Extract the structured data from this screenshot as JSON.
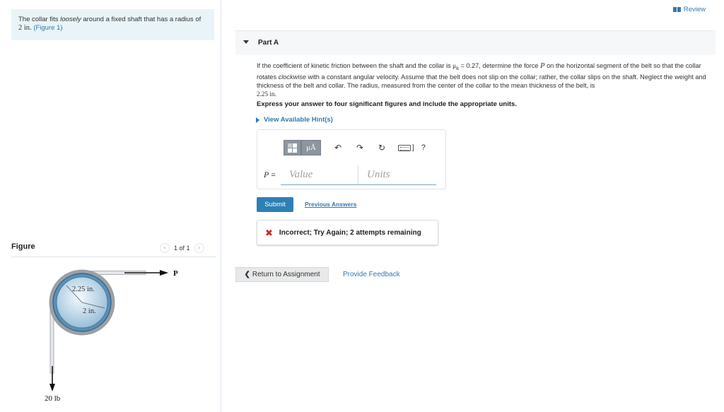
{
  "intro": {
    "text_1": "The collar fits ",
    "text_italic": "loosely",
    "text_2": " around a fixed shaft that has a radius of",
    "radius_value": "2 in.",
    "figure_link": "(Figure 1)"
  },
  "review": {
    "label": "Review"
  },
  "part": {
    "title": "Part A"
  },
  "problem": {
    "s1": "If the coefficient of kinetic friction between the shaft and the collar is ",
    "mu_symbol": "μ",
    "mu_sub": "k",
    "s2": " = 0.27, determine the force ",
    "P": "P",
    "s3": " on the horizontal segment of the belt so that the collar rotates ",
    "clockwise": "clockwise",
    "s4": " with a constant angular velocity. Assume that the belt does not slip on the collar; rather, the collar slips on the shaft. Neglect the weight and thickness of the belt and collar. The radius, measured from the center of the collar to the mean thickness of the belt, is ",
    "radius": "2.25 in."
  },
  "instruction": "Express your answer to four significant figures and include the appropriate units.",
  "hints": {
    "label": "View Available Hint(s)"
  },
  "answer": {
    "variable": "P",
    "equals": "=",
    "value_placeholder": "Value",
    "units_placeholder": "Units",
    "toolbar": {
      "mu_label": "μÅ",
      "undo_glyph": "↶",
      "redo_glyph": "↷",
      "reset_glyph": "↻",
      "bracket": "]",
      "help": "?"
    }
  },
  "actions": {
    "submit": "Submit",
    "previous_answers": "Previous Answers"
  },
  "feedback": {
    "icon": "✖",
    "text": "Incorrect; Try Again; 2 attempts remaining"
  },
  "footer": {
    "return_chevron": "❮",
    "return_label": "Return to Assignment",
    "feedback_link": "Provide Feedback"
  },
  "figure": {
    "title": "Figure",
    "prev": "‹",
    "next": "›",
    "count": "1 of 1",
    "label_outer_radius": "2.25 in.",
    "label_inner_radius": "2 in.",
    "label_force": "P",
    "label_weight": "20 lb"
  },
  "colors": {
    "accent": "#3278b0",
    "submit": "#2e7fb4",
    "error": "#d02323",
    "intro_bg": "#e8f4f8"
  }
}
